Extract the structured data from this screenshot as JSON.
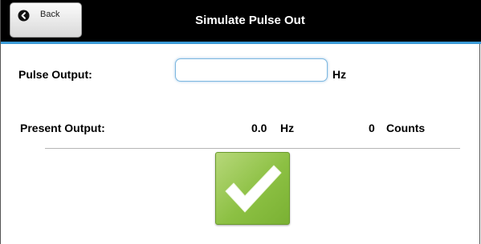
{
  "header": {
    "title": "Simulate Pulse Out",
    "back_label": "Back"
  },
  "pulse_output": {
    "label": "Pulse Output:",
    "value": "",
    "unit": "Hz"
  },
  "present_output": {
    "label": "Present Output:",
    "frequency_value": "0.0",
    "frequency_unit": "Hz",
    "count_value": "0",
    "count_unit": "Counts"
  },
  "icons": {
    "back": "arrow-circle-left-icon",
    "confirm": "checkmark-icon"
  },
  "colors": {
    "header_bg": "#000000",
    "header_accent": "#3a9ad6",
    "confirm_green": "#8cc043"
  }
}
